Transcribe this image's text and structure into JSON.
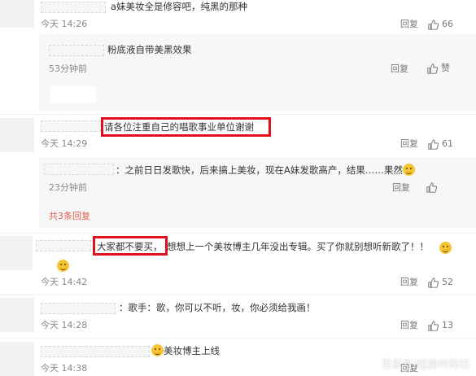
{
  "comments": [
    {
      "text": "a妹美妆全是修容吧，纯黑的那种",
      "time": "今天 14:26",
      "reply": "回复",
      "likes": "66",
      "sub": {
        "text": "粉底液自带美黑效果",
        "time": "53分钟前",
        "reply": "回复",
        "like": "赞"
      }
    },
    {
      "text": "请各位注重自己的唱歌事业单位谢谢",
      "time": "今天 14:29",
      "reply": "回复",
      "likes": "61",
      "sub": {
        "text": "：之前日日发歌快，后来搞上美妆，现在A妹发歌高产，结果……果然",
        "time": "23分钟前",
        "reply": "回复"
      },
      "more": "共3条回复"
    },
    {
      "text_highlight": "大家都不要买，",
      "text_rest": "想想上一个美妆博主几年没出专辑。买了你就别想听新歌了！！",
      "time": "今天 14:42",
      "reply": "回复",
      "likes": "52"
    },
    {
      "text": "：歌手：歌，你可以不听，妆，你必须给我画！",
      "time": "今天 14:28",
      "reply": "回复",
      "likes": "13"
    },
    {
      "text": "美妆博主上线",
      "time": "今天 14:38",
      "reply": "回复"
    }
  ],
  "watermark": "百家号/超美时尚坊",
  "icons": [
    "thumbs-up-icon",
    "smile-emoji-icon"
  ]
}
